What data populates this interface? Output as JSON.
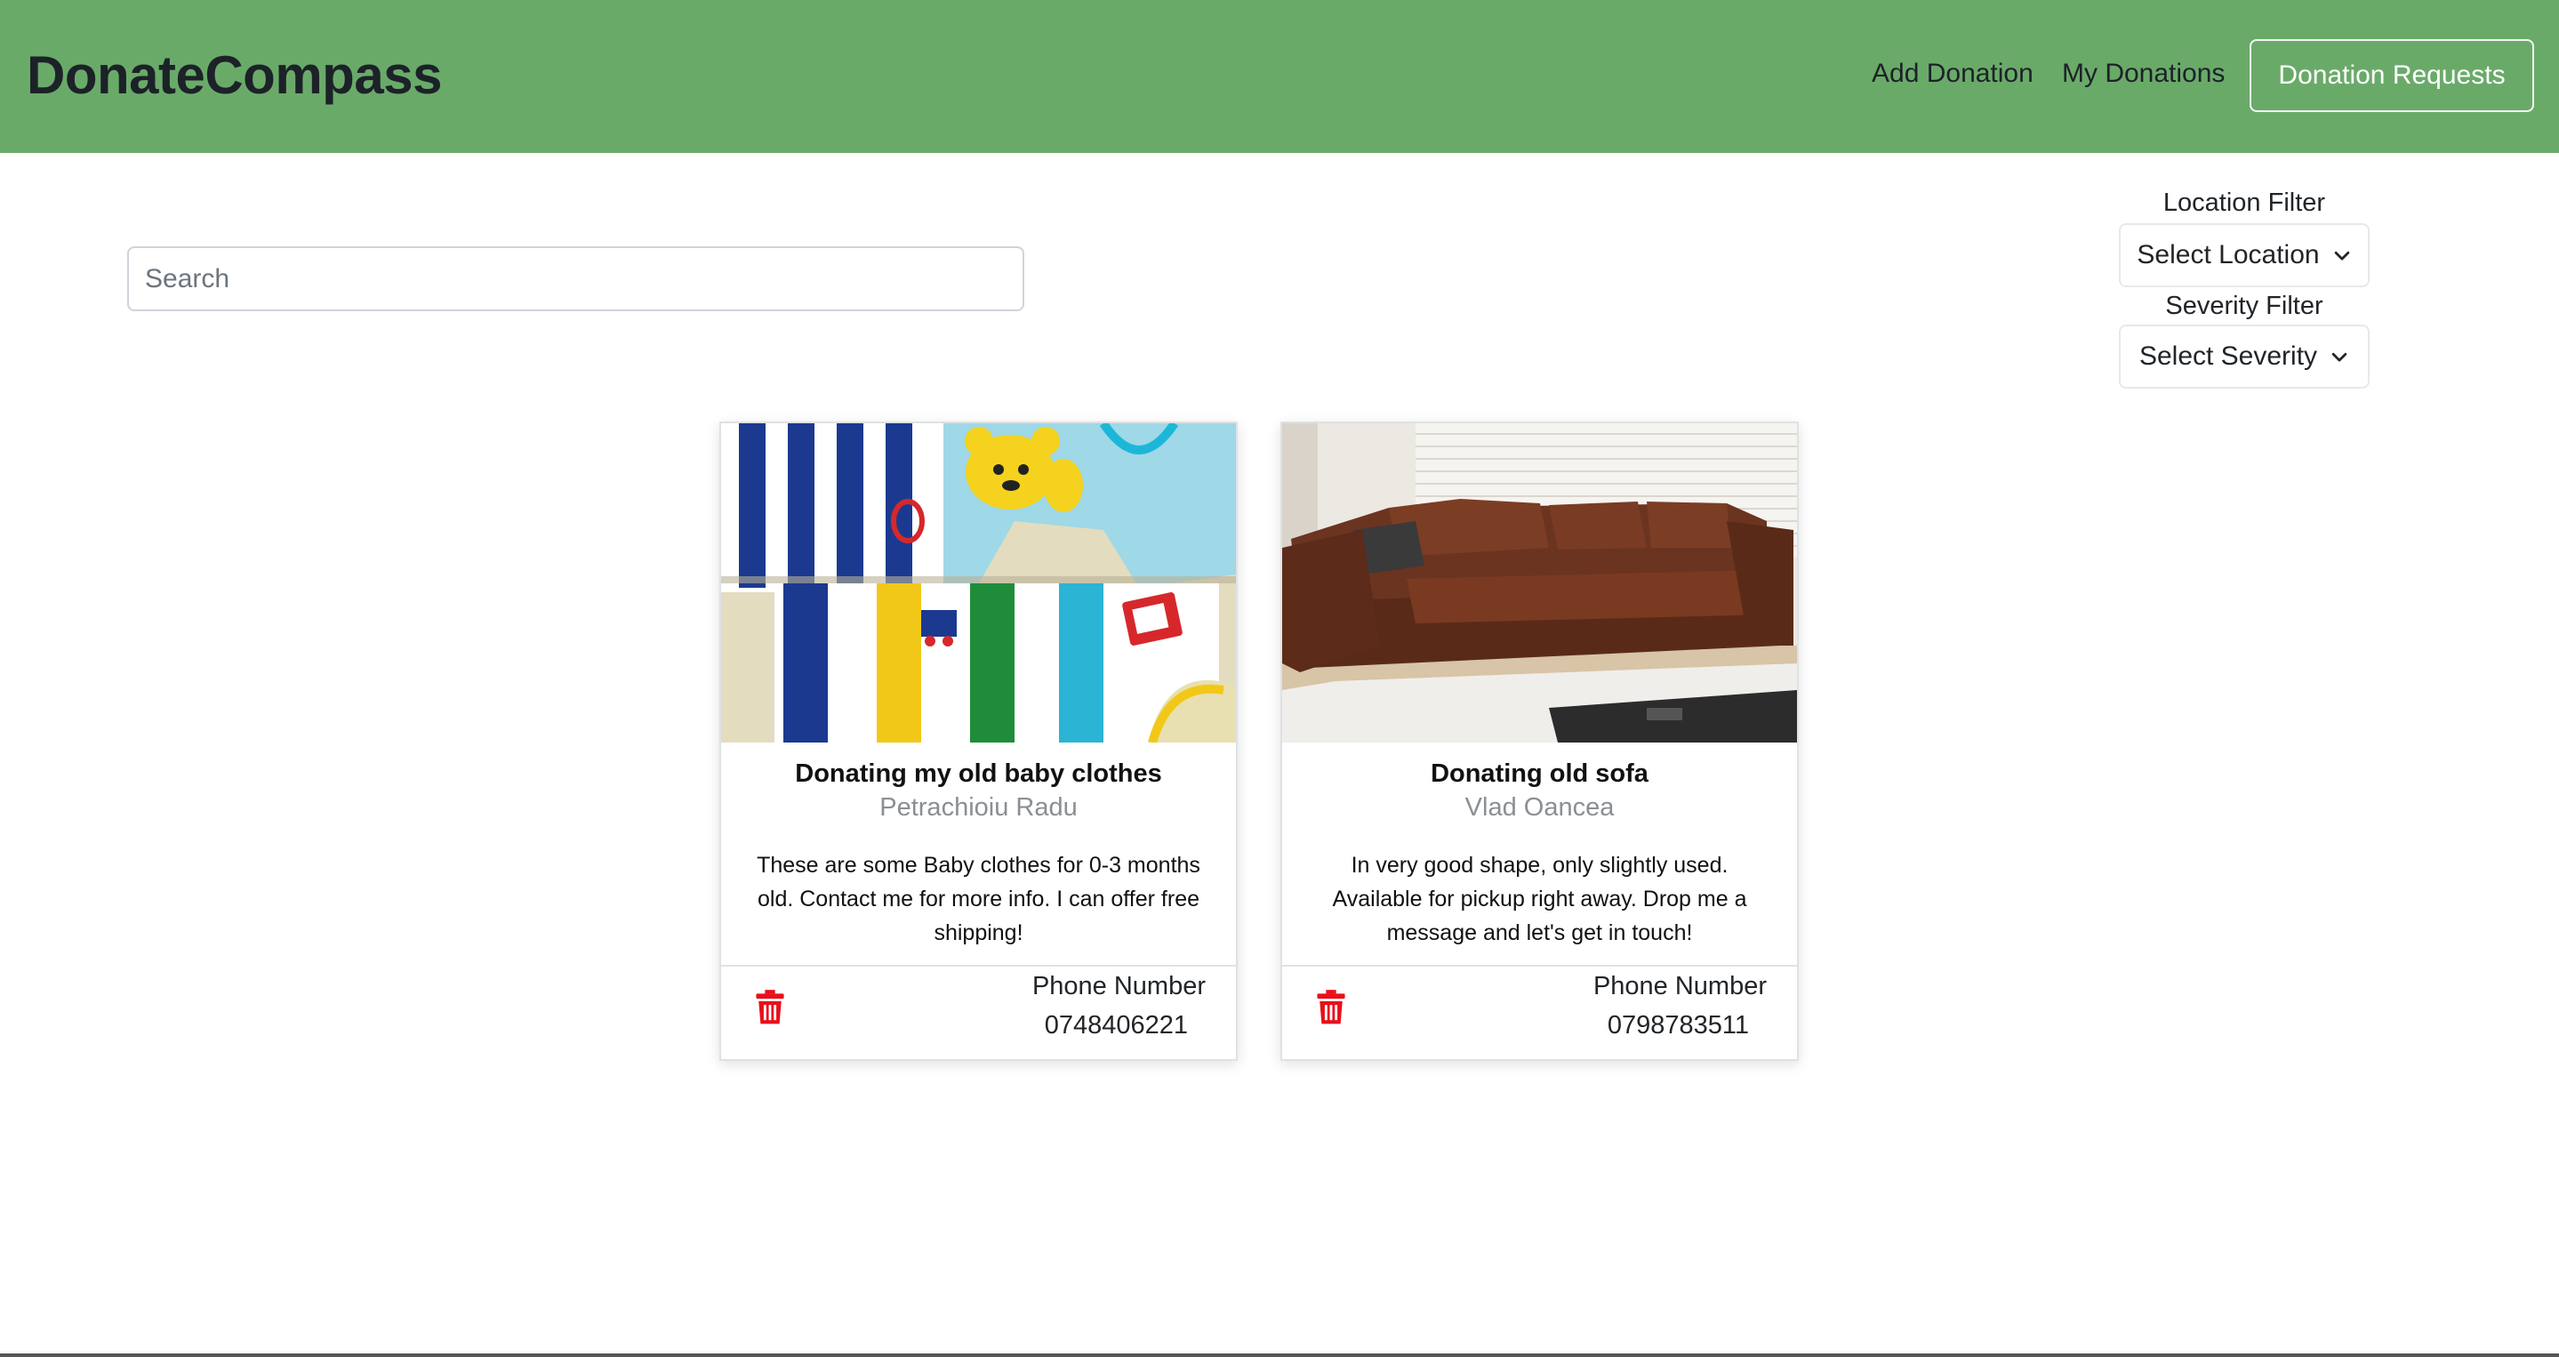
{
  "navbar": {
    "brand": "DonateCompass",
    "links": [
      "Add Donation",
      "My Donations"
    ],
    "button_label": "Donation Requests",
    "background": "#6aaa69"
  },
  "search": {
    "placeholder": "Search",
    "value": ""
  },
  "filters": {
    "location_label": "Location Filter",
    "location_selected": "Select Location",
    "severity_label": "Severity Filter",
    "severity_selected": "Select Severity"
  },
  "cards": [
    {
      "title": "Donating my old baby clothes",
      "author": "Petrachioiu Radu",
      "description": "These are some Baby clothes for 0-3 months old. Contact me for more info. I can offer free shipping!",
      "phone_label": "Phone Number",
      "phone": "0748406221",
      "image": "baby-clothes-photo"
    },
    {
      "title": "Donating old sofa",
      "author": "Vlad Oancea",
      "description": "In very good shape, only slightly used. Available for pickup right away. Drop me a message and let's get in touch!",
      "phone_label": "Phone Number",
      "phone": "0798783511",
      "image": "leather-sofa-photo"
    }
  ],
  "icons": {
    "delete": "trash-icon",
    "dropdown": "chevron-down-icon"
  },
  "colors": {
    "accent_green": "#6aaa69",
    "delete_red": "#e8101a"
  }
}
